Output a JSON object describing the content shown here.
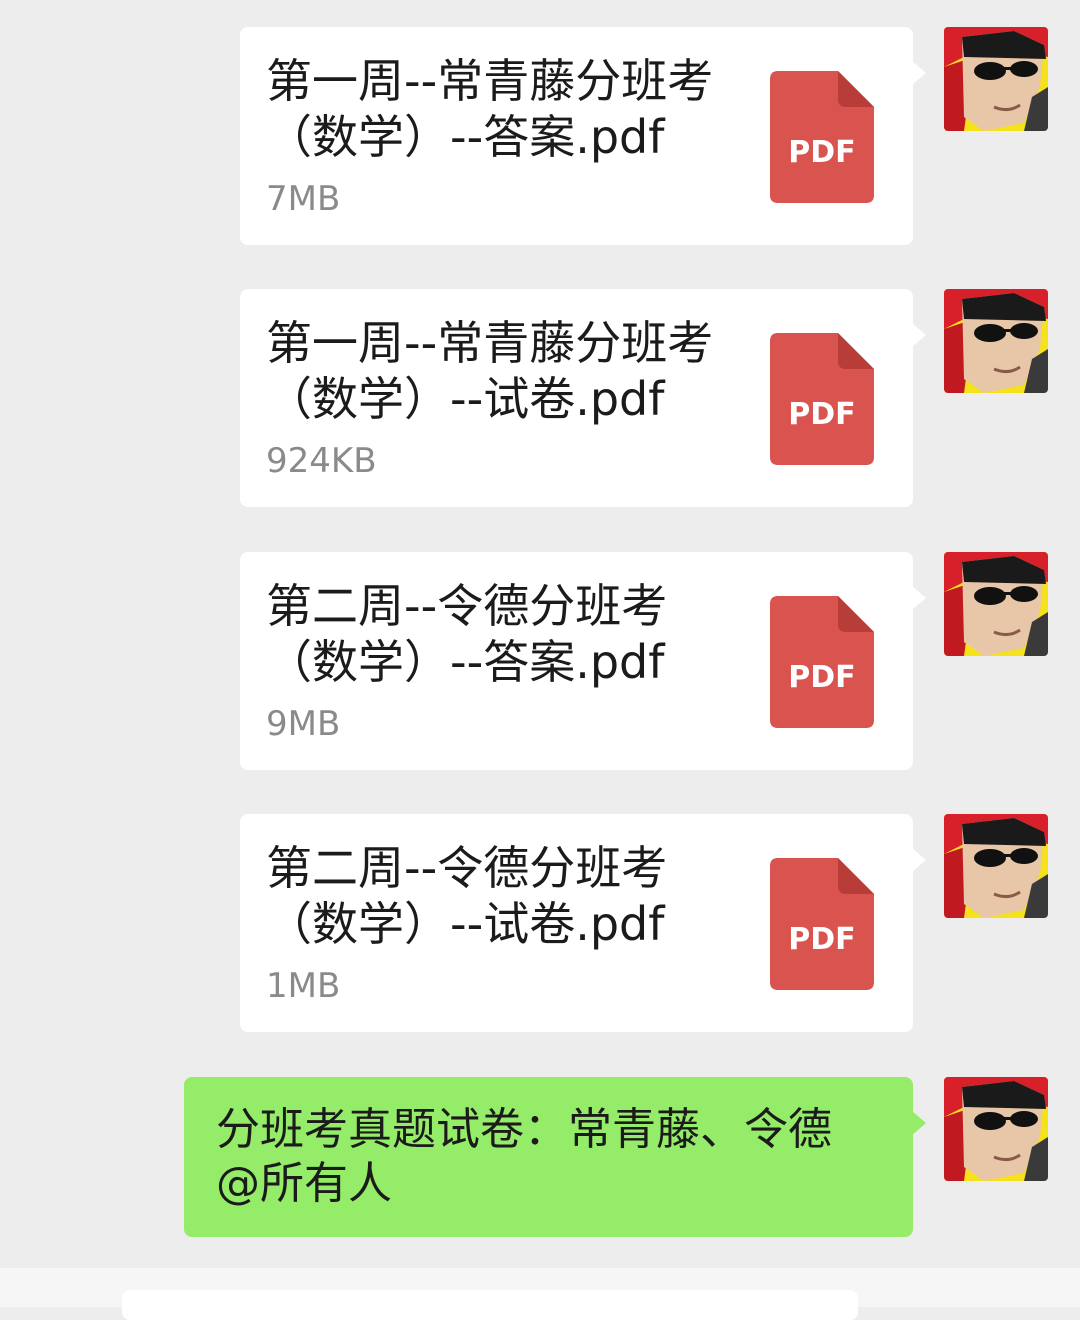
{
  "messages": [
    {
      "type": "file",
      "name": "第一周--常青藤分班考（数学）--答案.pdf",
      "size": "7MB",
      "icon": "pdf-file-icon",
      "icon_label": "PDF"
    },
    {
      "type": "file",
      "name": "第一周--常青藤分班考（数学）--试卷.pdf",
      "size": "924KB",
      "icon": "pdf-file-icon",
      "icon_label": "PDF"
    },
    {
      "type": "file",
      "name": "第二周--令德分班考（数学）--答案.pdf",
      "size": "9MB",
      "icon": "pdf-file-icon",
      "icon_label": "PDF"
    },
    {
      "type": "file",
      "name": "第二周--令德分班考（数学）--试卷.pdf",
      "size": "1MB",
      "icon": "pdf-file-icon",
      "icon_label": "PDF"
    },
    {
      "type": "text",
      "text_line1": "分班考真题试卷：常青藤、令德",
      "text_line2": "@所有人"
    }
  ],
  "colors": {
    "background": "#ededed",
    "file_bubble": "#ffffff",
    "sent_bubble": "#95ec69",
    "pdf_red": "#d9534f",
    "file_size_gray": "#8a8a8a"
  }
}
